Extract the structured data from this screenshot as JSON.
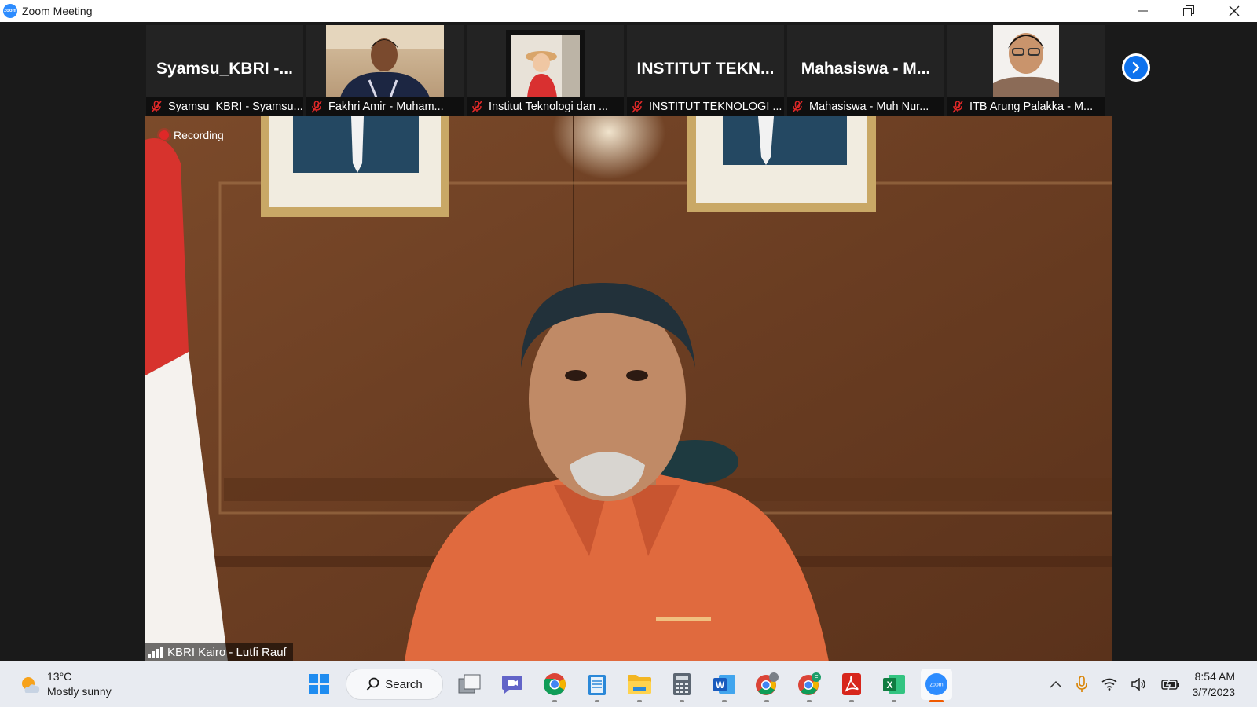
{
  "window": {
    "title": "Zoom Meeting",
    "app_icon_text": "zoom"
  },
  "participants": [
    {
      "big_name": "Syamsu_KBRI  -...",
      "caption": "Syamsu_KBRI - Syamsu...",
      "has_video": false
    },
    {
      "big_name": "",
      "caption": "Fakhri Amir - Muham...",
      "has_video": true
    },
    {
      "big_name": "",
      "caption": "Institut Teknologi dan ...",
      "has_video": true
    },
    {
      "big_name": "INSTITUT  TEKN...",
      "caption": "INSTITUT TEKNOLOGI ...",
      "has_video": false
    },
    {
      "big_name": "Mahasiswa  -  M...",
      "caption": "Mahasiswa - Muh Nur...",
      "has_video": false
    },
    {
      "big_name": "",
      "caption": "ITB Arung Palakka - M...",
      "has_video": true
    }
  ],
  "main_video": {
    "recording_label": "Recording",
    "speaker_label": "KBRI Kairo - Lutfi Rauf"
  },
  "taskbar": {
    "weather": {
      "temp": "13°C",
      "condition": "Mostly sunny"
    },
    "search_label": "Search",
    "apps": [
      "start-icon",
      "search",
      "task-view-icon",
      "teams-chat-icon",
      "chrome-icon",
      "notepad-icon",
      "file-explorer-icon",
      "calculator-icon",
      "word-icon",
      "chrome-profile-icon",
      "chrome-profile-f-icon",
      "acrobat-icon",
      "excel-icon",
      "zoom-icon"
    ],
    "clock": {
      "time": "8:54 AM",
      "date": "3/7/2023"
    }
  },
  "colors": {
    "zoom_blue": "#2d8cff",
    "next_blue": "#0e72ed",
    "mute_red": "#e02828",
    "active_indicator": "#f05a00"
  }
}
